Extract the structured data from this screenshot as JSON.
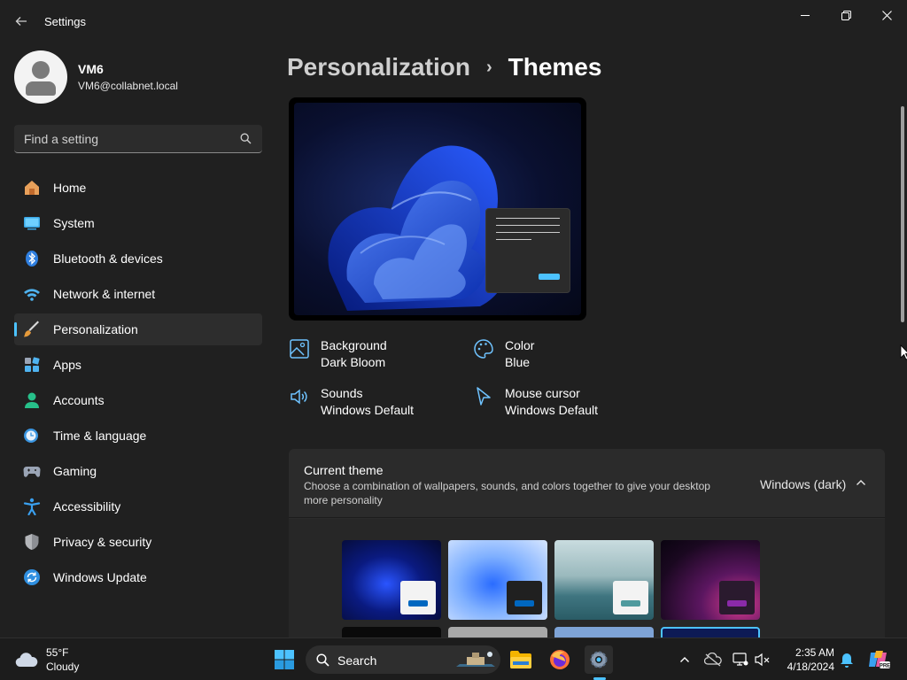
{
  "window": {
    "title": "Settings",
    "controls": {
      "minimize": "minimize-icon",
      "restore": "restore-icon",
      "close": "close-icon"
    }
  },
  "profile": {
    "name": "VM6",
    "email": "VM6@collabnet.local"
  },
  "search": {
    "placeholder": "Find a setting"
  },
  "sidebar": {
    "items": [
      {
        "label": "Home",
        "icon": "home-icon"
      },
      {
        "label": "System",
        "icon": "system-icon"
      },
      {
        "label": "Bluetooth & devices",
        "icon": "bluetooth-icon"
      },
      {
        "label": "Network & internet",
        "icon": "wifi-icon"
      },
      {
        "label": "Personalization",
        "icon": "brush-icon",
        "active": true
      },
      {
        "label": "Apps",
        "icon": "apps-icon"
      },
      {
        "label": "Accounts",
        "icon": "accounts-icon"
      },
      {
        "label": "Time & language",
        "icon": "clock-globe-icon"
      },
      {
        "label": "Gaming",
        "icon": "gamepad-icon"
      },
      {
        "label": "Accessibility",
        "icon": "accessibility-icon"
      },
      {
        "label": "Privacy & security",
        "icon": "shield-icon"
      },
      {
        "label": "Windows Update",
        "icon": "update-icon"
      }
    ]
  },
  "breadcrumb": {
    "parent": "Personalization",
    "separator": "›",
    "current": "Themes"
  },
  "properties": {
    "background": {
      "title": "Background",
      "value": "Dark Bloom"
    },
    "color": {
      "title": "Color",
      "value": "Blue"
    },
    "sounds": {
      "title": "Sounds",
      "value": "Windows Default"
    },
    "cursor": {
      "title": "Mouse cursor",
      "value": "Windows Default"
    }
  },
  "current_theme": {
    "title": "Current theme",
    "description": "Choose a combination of wallpapers, sounds, and colors together to give your desktop more personality",
    "value": "Windows (dark)"
  },
  "themes": [
    {
      "name": "windows-dark-theme"
    },
    {
      "name": "windows-light-theme"
    },
    {
      "name": "glow-theme"
    },
    {
      "name": "captured-motion-theme"
    }
  ],
  "taskbar": {
    "weather": {
      "temp": "55°F",
      "condition": "Cloudy"
    },
    "search_label": "Search",
    "time": "2:35 AM",
    "date": "4/18/2024"
  },
  "colors": {
    "accent": "#4cc2ff",
    "background": "#202020",
    "card": "#2b2b2b"
  }
}
